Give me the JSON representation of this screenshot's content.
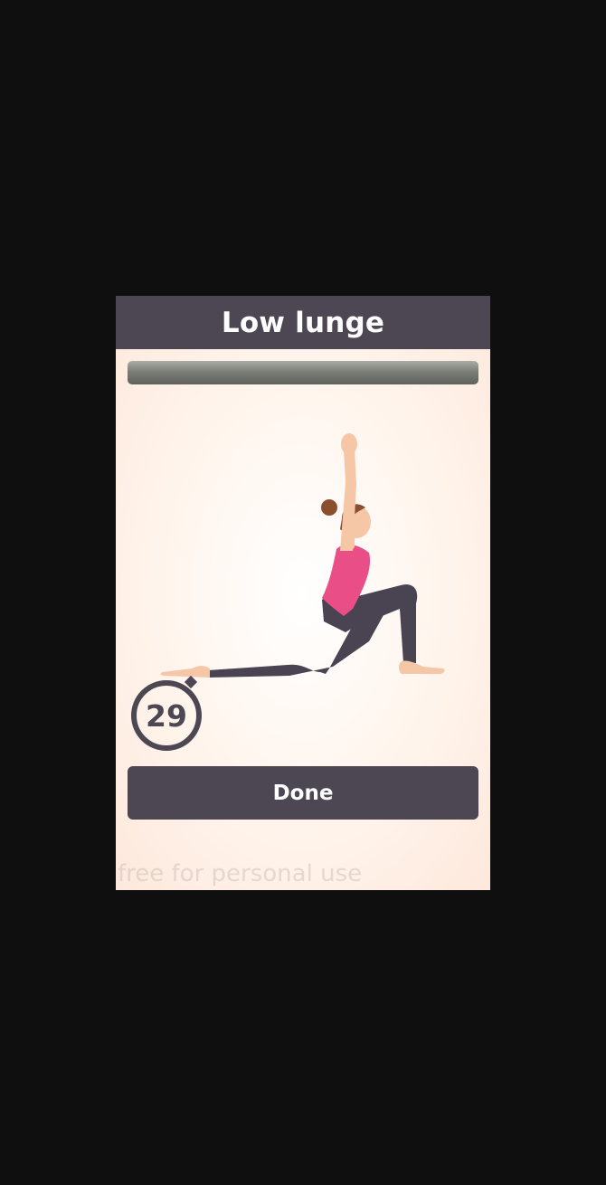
{
  "dialog": {
    "title": "Low lunge",
    "progress_fraction": 0.0,
    "timer_seconds": "29",
    "done_label": "Done",
    "watermark": "free for personal use"
  },
  "colors": {
    "header_bg": "#4d4754",
    "button_bg": "#4d4754",
    "shirt": "#e94e86",
    "pants": "#4a4452",
    "skin": "#f6c7a6",
    "hair": "#8a4f2c",
    "progress_track": "#7c7f78"
  },
  "icons": {
    "pose": "low-lunge-pose-illustration",
    "timer": "stopwatch-icon"
  }
}
